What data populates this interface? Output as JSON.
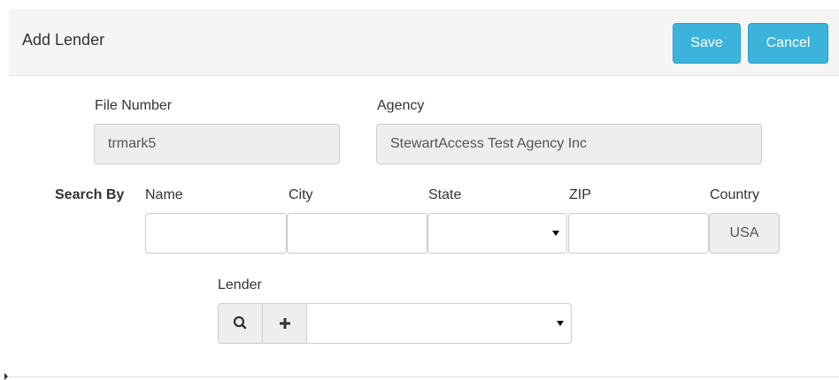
{
  "header": {
    "title": "Add Lender",
    "save_label": "Save",
    "cancel_label": "Cancel",
    "accent_color": "#3bb3da"
  },
  "file_number": {
    "label": "File Number",
    "value": "trmark5"
  },
  "agency": {
    "label": "Agency",
    "value": "StewartAccess Test Agency Inc"
  },
  "search": {
    "label": "Search By",
    "name_label": "Name",
    "city_label": "City",
    "state_label": "State",
    "zip_label": "ZIP",
    "country_label": "Country",
    "name_value": "",
    "city_value": "",
    "state_value": "",
    "zip_value": "",
    "country_value": "USA"
  },
  "lender": {
    "label": "Lender",
    "search_icon": "search-icon",
    "add_icon": "plus-icon",
    "selected_value": ""
  }
}
